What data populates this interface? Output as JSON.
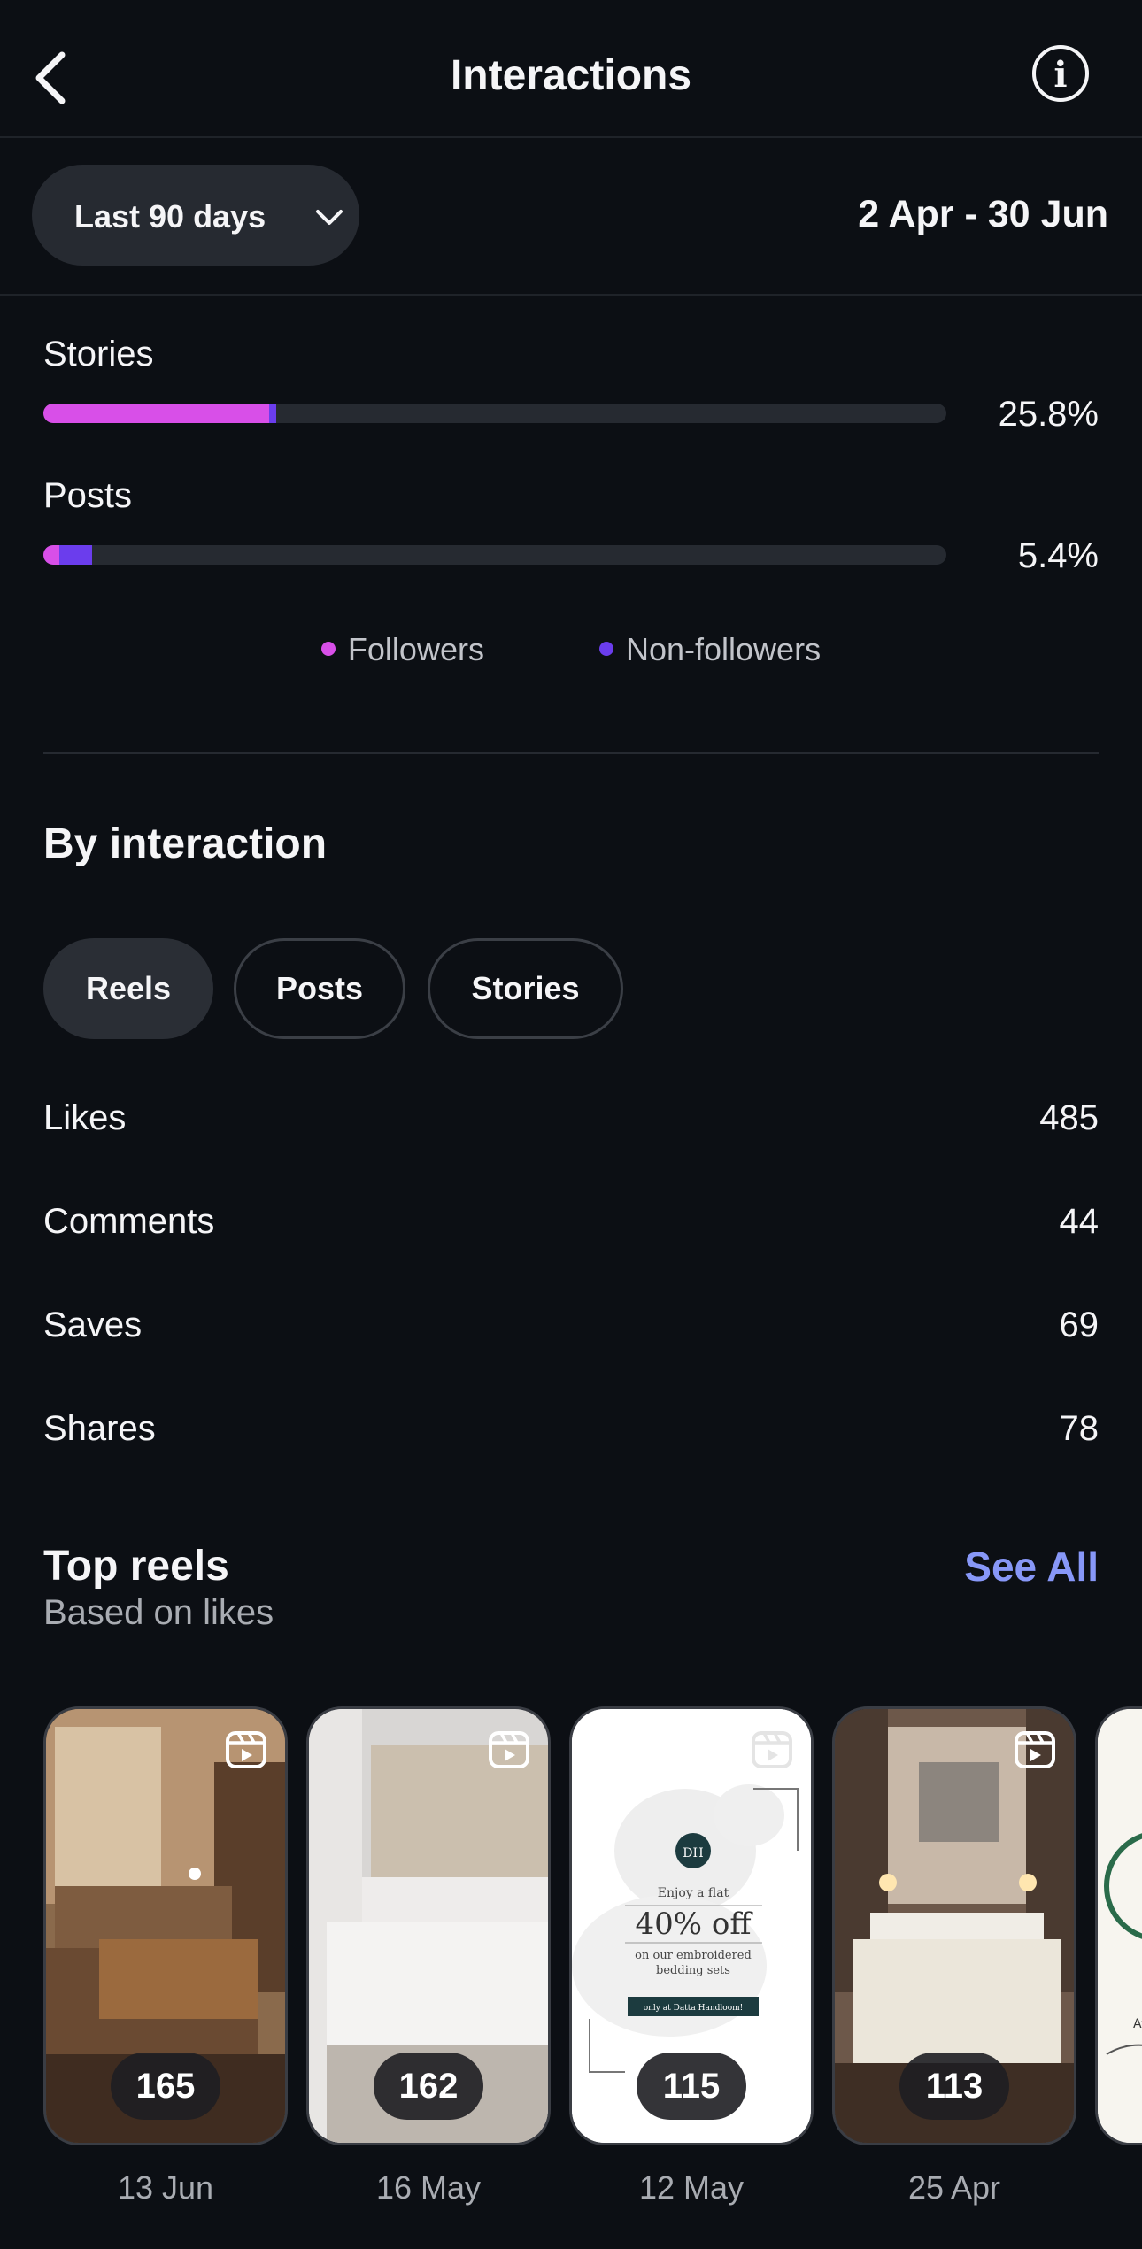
{
  "header": {
    "title": "Interactions",
    "back_icon": "back-arrow-icon",
    "info_icon": "info-icon"
  },
  "filter": {
    "range_label": "Last 90 days",
    "date_range": "2 Apr - 30 Jun"
  },
  "audience_breakdown": {
    "bars": [
      {
        "label": "Stories",
        "percent": "25.8%",
        "followers_fraction": 0.25,
        "non_followers_fraction": 0.008
      },
      {
        "label": "Posts",
        "percent": "5.4%",
        "followers_fraction": 0.018,
        "non_followers_fraction": 0.036
      }
    ],
    "legend": [
      {
        "label": "Followers",
        "color": "#d84fe8"
      },
      {
        "label": "Non-followers",
        "color": "#6b3ded"
      }
    ]
  },
  "by_interaction": {
    "title": "By interaction",
    "tabs": [
      {
        "label": "Reels",
        "active": true
      },
      {
        "label": "Posts",
        "active": false
      },
      {
        "label": "Stories",
        "active": false
      }
    ],
    "metrics": [
      {
        "label": "Likes",
        "value": "485"
      },
      {
        "label": "Comments",
        "value": "44"
      },
      {
        "label": "Saves",
        "value": "69"
      },
      {
        "label": "Shares",
        "value": "78"
      }
    ]
  },
  "top_reels": {
    "title": "Top reels",
    "subtitle": "Based on likes",
    "see_all": "See All",
    "items": [
      {
        "count": "165",
        "date": "13 Jun"
      },
      {
        "count": "162",
        "date": "16 May"
      },
      {
        "count": "115",
        "date": "12 May",
        "promo": {
          "logo": "DH",
          "line1": "Enjoy a flat",
          "line2": "40% off",
          "line3": "on our embroidered",
          "line4": "bedding sets",
          "line5": "only at Datta Handloom!"
        }
      },
      {
        "count": "113",
        "date": "25 Apr"
      }
    ],
    "partial_item_text": "At"
  }
}
